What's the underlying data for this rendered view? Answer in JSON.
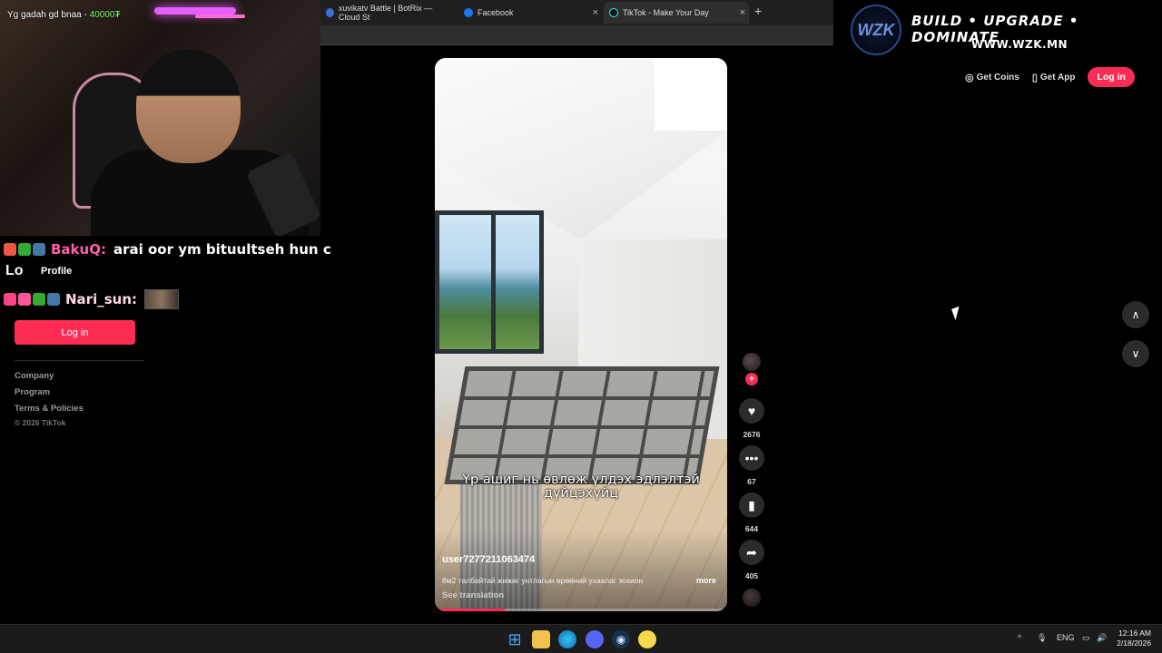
{
  "browser": {
    "tabs": [
      {
        "label": "xuvikatv Battle | BotRix — Cloud St",
        "icon": "botrix-icon"
      },
      {
        "label": "Facebook",
        "icon": "facebook-icon"
      },
      {
        "label": "TikTok - Make Your Day",
        "icon": "tiktok-icon",
        "active": true
      }
    ],
    "close_glyph": "×",
    "new_tab_glyph": "+"
  },
  "stream": {
    "goal_text": "Yg gadah gd bnaa - ",
    "goal_amount": "40000₮",
    "chat": [
      {
        "user": "BakuQ:",
        "message": "arai oor ym bituultseh hun c"
      },
      {
        "user": "Nari_sun:",
        "message": ""
      }
    ],
    "brand": {
      "logo_text": "WZK",
      "slogan": "BUILD • UPGRADE • DOMINATE",
      "url": "WWW.WZK.MN"
    }
  },
  "sidebar": {
    "profile_icon": "Lo",
    "profile_label": "Profile",
    "login_label": "Log in",
    "links": [
      "Company",
      "Program",
      "Terms & Policies"
    ],
    "copyright": "© 2026 TikTok"
  },
  "header": {
    "get_coins": "Get Coins",
    "get_app": "Get App",
    "login": "Log in"
  },
  "video": {
    "subtitle": "Үр ашиг нь өвлөж үлдэх эдлэлтэй дүйцэхүйц",
    "author": "user7277211063474",
    "description": "8м2 талбайтай жижиг унтлагын өрөөний ухаалаг зохион",
    "more": "more",
    "see_translation": "See translation",
    "progress": 0.24,
    "counts": {
      "likes": "2676",
      "comments": "67",
      "saves": "644",
      "shares": "405"
    }
  },
  "nav": {
    "up_glyph": "∧",
    "down_glyph": "∨"
  },
  "taskbar": {
    "lang": "ENG",
    "time": "12:16 AM",
    "date": "2/18/2026"
  },
  "colors": {
    "accent": "#fe2c55",
    "background": "#000000"
  }
}
